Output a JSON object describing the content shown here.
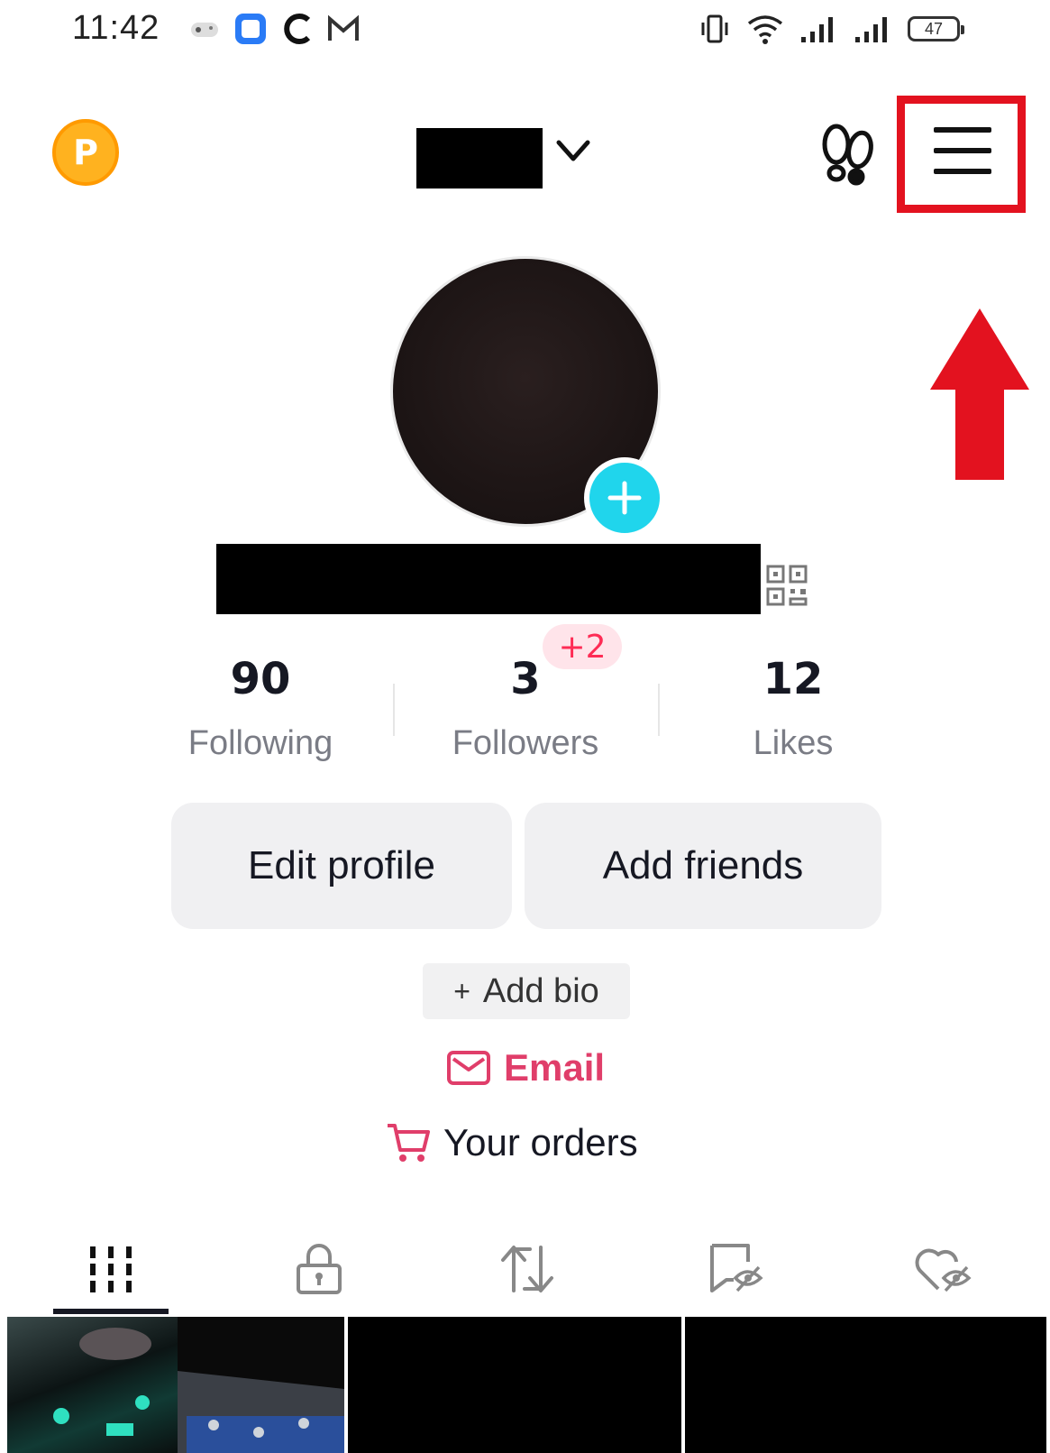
{
  "status_bar": {
    "time": "11:42",
    "battery": "47"
  },
  "header": {
    "coin_letter": "P"
  },
  "stats": [
    {
      "value": "90",
      "label": "Following"
    },
    {
      "value": "3",
      "label": "Followers",
      "badge": "+2"
    },
    {
      "value": "12",
      "label": "Likes"
    }
  ],
  "actions": {
    "edit_profile": "Edit profile",
    "add_friends": "Add friends"
  },
  "bio": {
    "add_bio_plus": "+",
    "add_bio_label": "Add bio"
  },
  "links": {
    "email": "Email",
    "orders": "Your orders"
  },
  "tabs": [
    {
      "icon": "videos-grid-icon",
      "active": true
    },
    {
      "icon": "lock-icon",
      "active": false
    },
    {
      "icon": "repost-icon",
      "active": false
    },
    {
      "icon": "favorites-hidden-icon",
      "active": false
    },
    {
      "icon": "liked-hidden-icon",
      "active": false
    }
  ],
  "colors": {
    "highlight": "#e3121f",
    "accent_pink": "#fe2c55",
    "cyan": "#20d5ec"
  }
}
